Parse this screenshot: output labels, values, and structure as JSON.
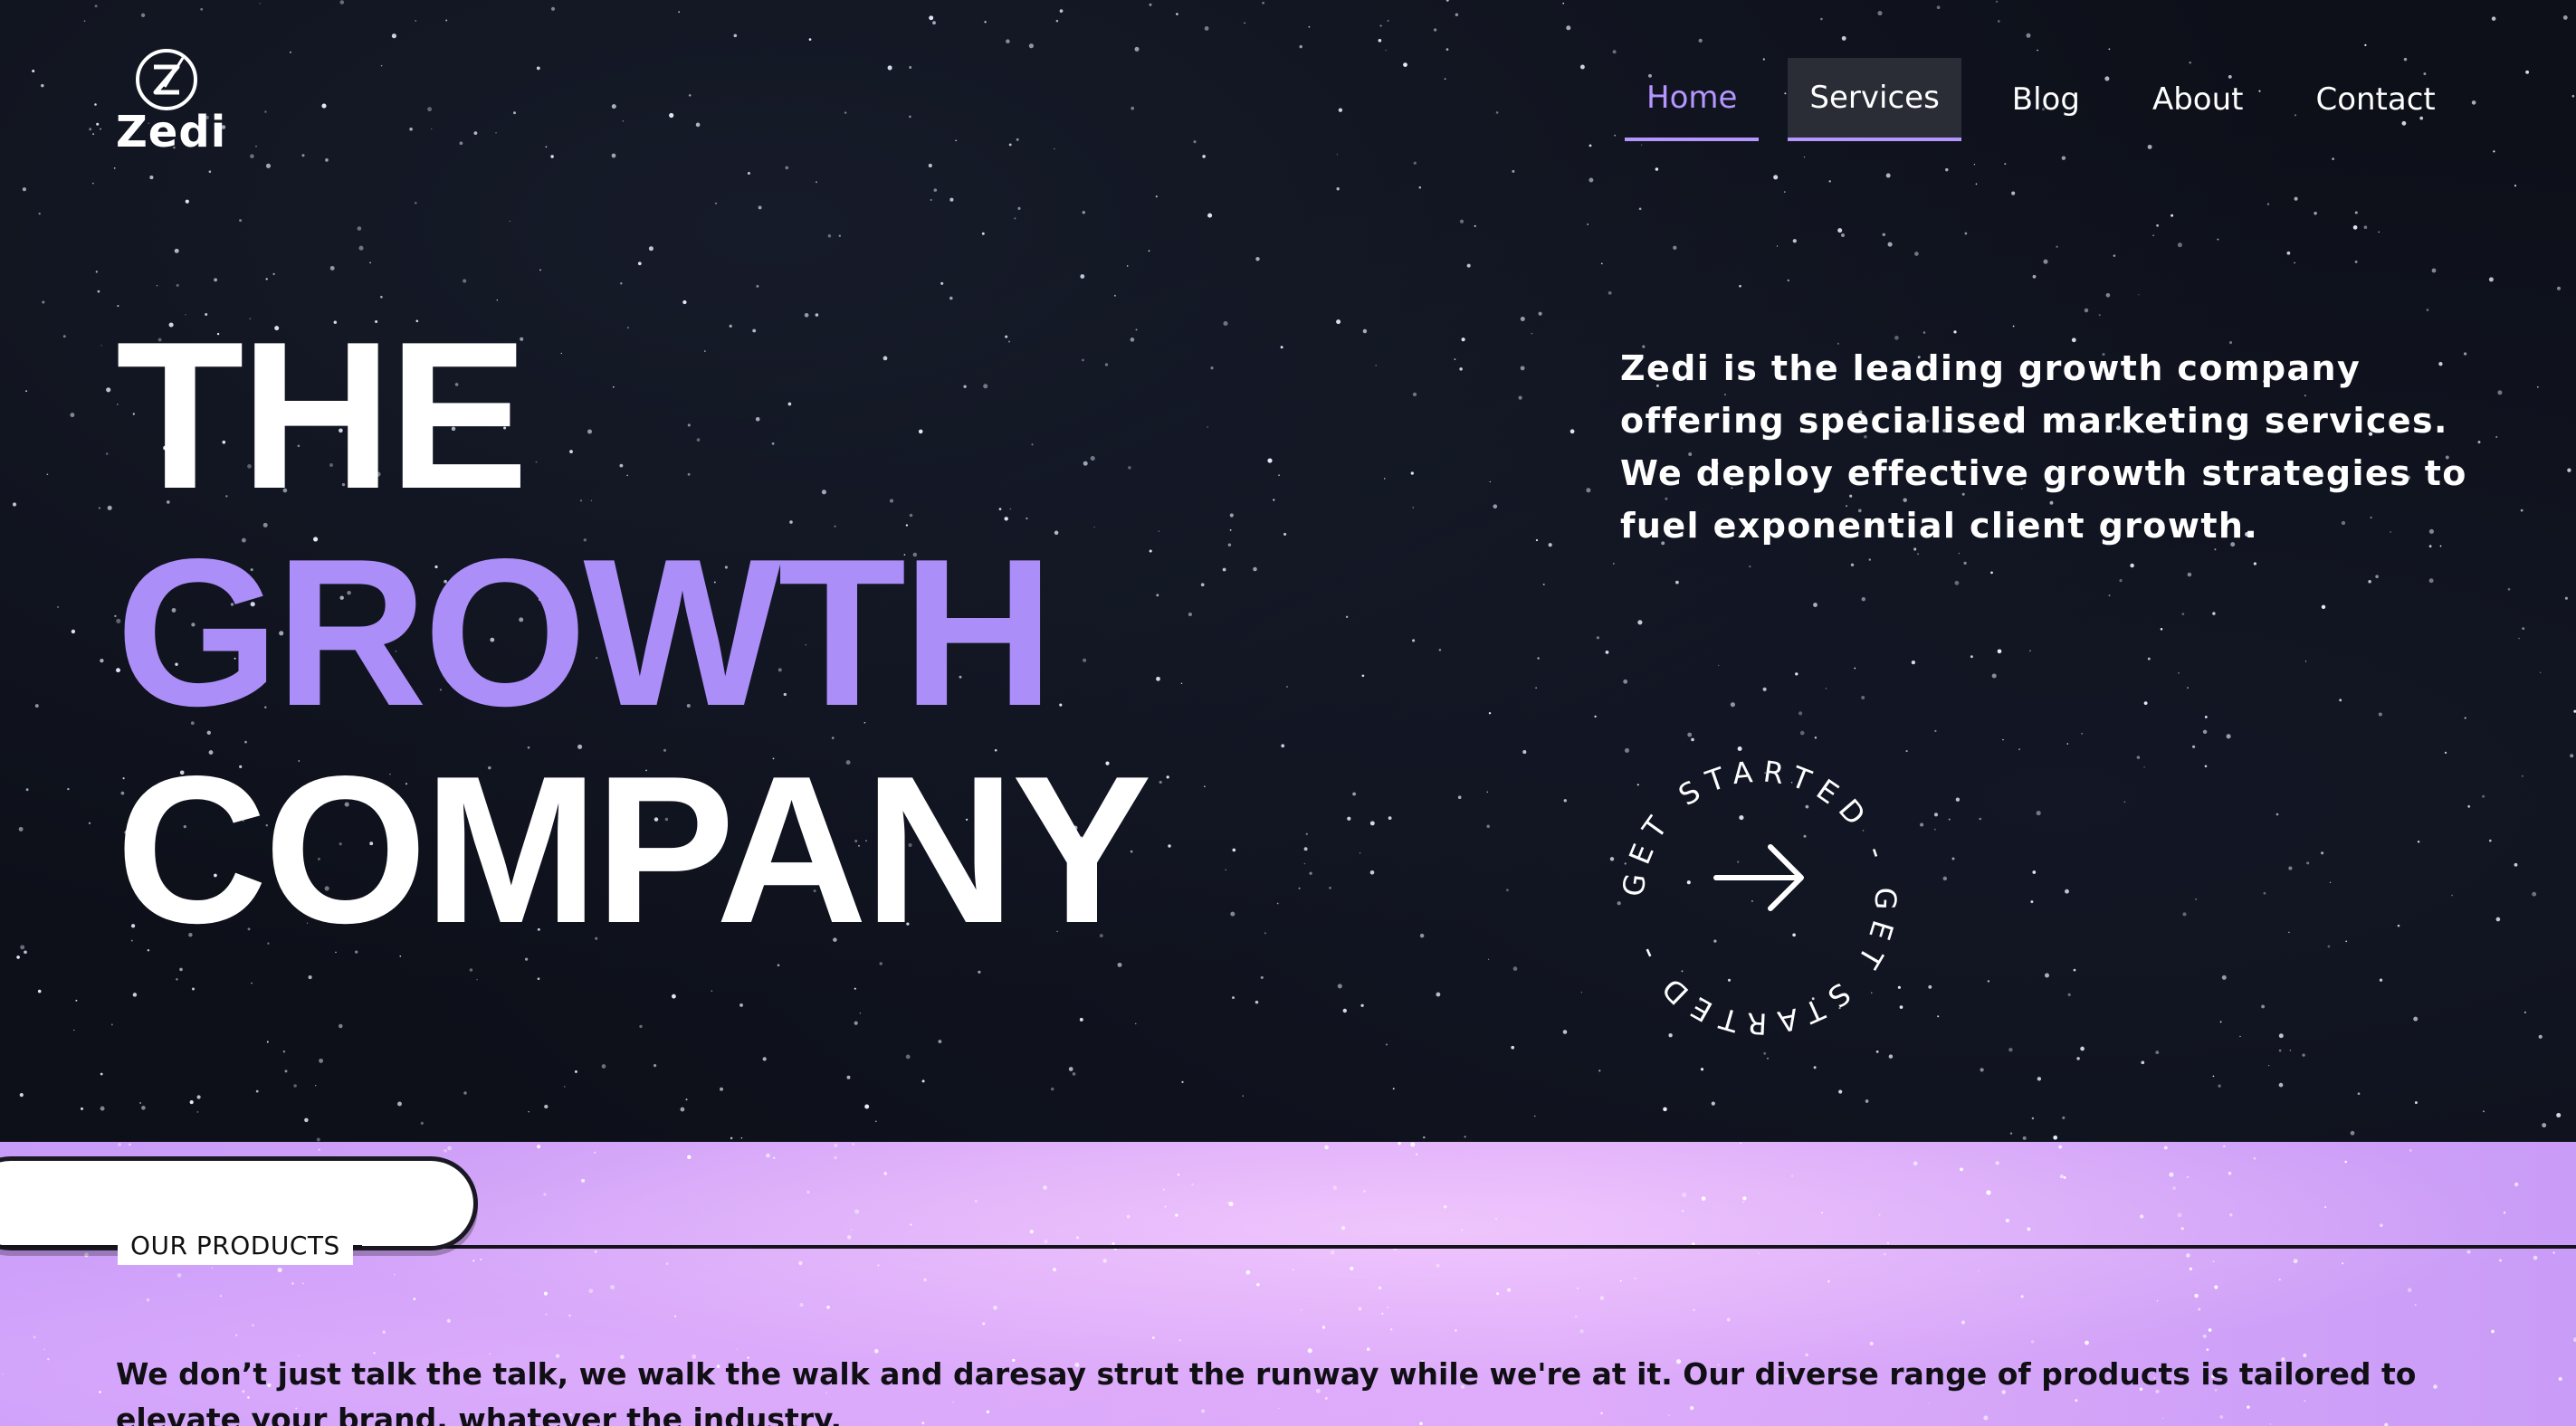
{
  "brand": {
    "name": "Zedi",
    "logo_icon": "z-circle-logo-icon"
  },
  "nav": {
    "items": [
      {
        "label": "Home",
        "state": "active"
      },
      {
        "label": "Services",
        "state": "hover"
      },
      {
        "label": "Blog",
        "state": "normal"
      },
      {
        "label": "About",
        "state": "normal"
      },
      {
        "label": "Contact",
        "state": "normal"
      }
    ]
  },
  "hero": {
    "headline_line1": "THE",
    "headline_line2": "GROWTH",
    "headline_line3": "COMPANY",
    "description": "Zedi is the leading growth company offering specialised marketing services. We deploy effective growth strategies to fuel exponential client growth.",
    "cta_text": "GET STARTED - GET STARTED - ",
    "cta_icon": "arrow-right-icon"
  },
  "products": {
    "label": "OUR PRODUCTS",
    "text": "We don’t just talk the talk, we walk the walk and daresay strut the runway while we're at it. Our diverse range of products is tailored to elevate your brand, whatever the industry."
  },
  "colors": {
    "accent": "#ab8ef7",
    "nav_active": "#b596ff",
    "background": "#0d1019",
    "products_bg": "#d8a6f8"
  }
}
